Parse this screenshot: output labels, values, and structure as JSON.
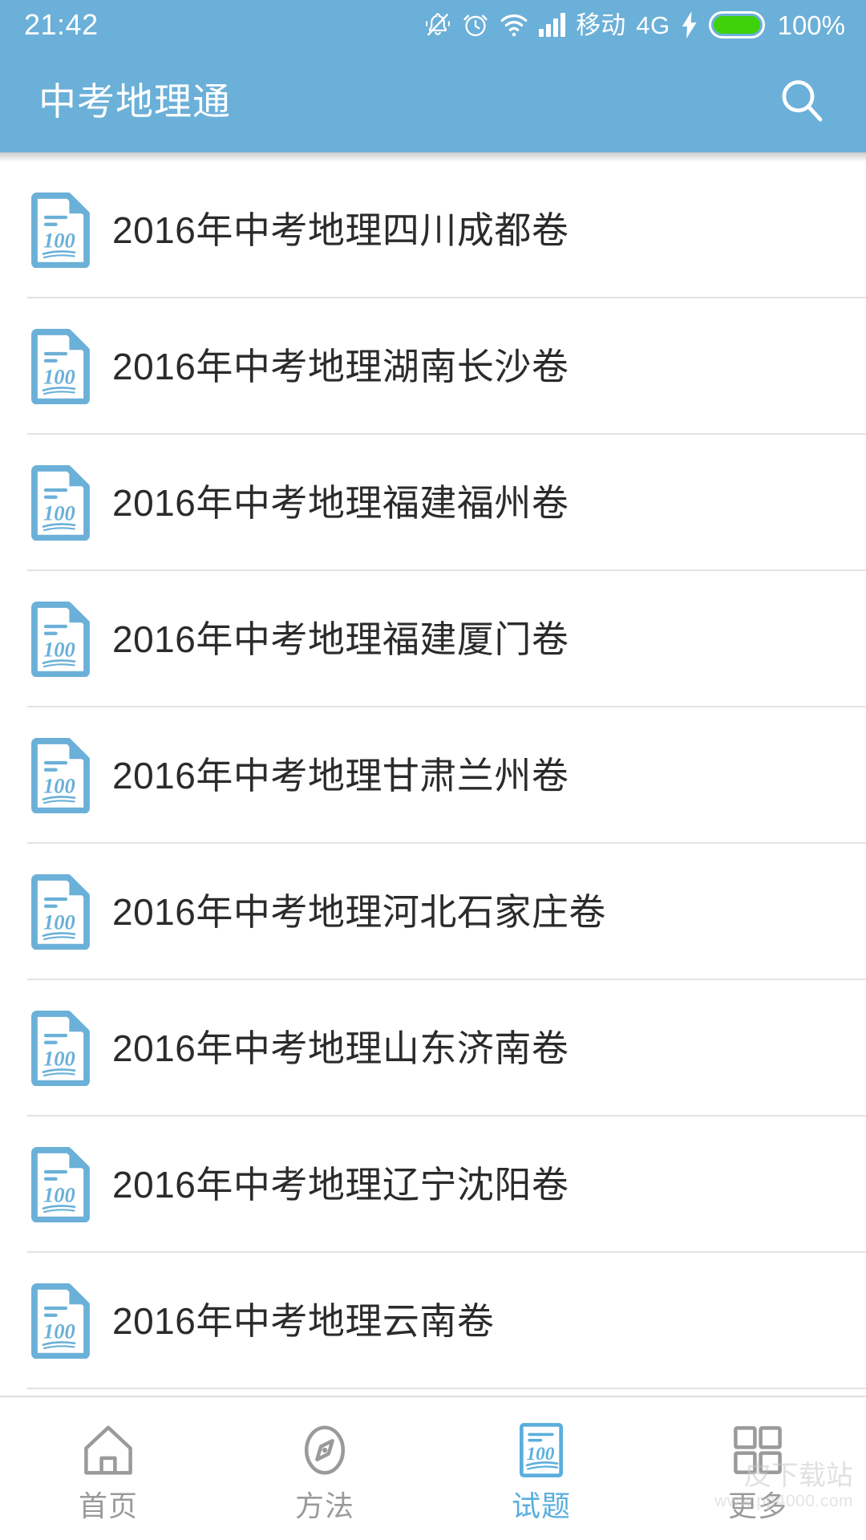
{
  "status_bar": {
    "clock": "21:42",
    "icons": [
      "bell-muted-icon",
      "alarm-clock-icon",
      "wifi-icon",
      "signal-bars-icon"
    ],
    "carrier": "移动",
    "network": "4G",
    "charging": true,
    "battery_percent": "100%",
    "battery_color": "#3fd10a",
    "background": "#6bb0d8"
  },
  "app_bar": {
    "title": "中考地理通",
    "search_icon": "search-icon",
    "background": "#6bb0d8",
    "text_color": "#ffffff"
  },
  "list": {
    "icon_name": "document-100-icon",
    "icon_color": "#6bb0d8",
    "items": [
      {
        "label": "2016年中考地理四川成都卷"
      },
      {
        "label": "2016年中考地理湖南长沙卷"
      },
      {
        "label": "2016年中考地理福建福州卷"
      },
      {
        "label": "2016年中考地理福建厦门卷"
      },
      {
        "label": "2016年中考地理甘肃兰州卷"
      },
      {
        "label": "2016年中考地理河北石家庄卷"
      },
      {
        "label": "2016年中考地理山东济南卷"
      },
      {
        "label": "2016年中考地理辽宁沈阳卷"
      },
      {
        "label": "2016年中考地理云南卷"
      }
    ]
  },
  "bottom_nav": {
    "active_color": "#5aaede",
    "inactive_color": "#9a9a9a",
    "items": [
      {
        "label": "首页",
        "icon": "home-icon",
        "active": false
      },
      {
        "label": "方法",
        "icon": "compass-icon",
        "active": false
      },
      {
        "label": "试题",
        "icon": "exam-100-icon",
        "active": true
      },
      {
        "label": "更多",
        "icon": "grid-icon",
        "active": false
      }
    ]
  },
  "watermark": {
    "text": "皮下载站",
    "url": "www.pp4000.com"
  }
}
